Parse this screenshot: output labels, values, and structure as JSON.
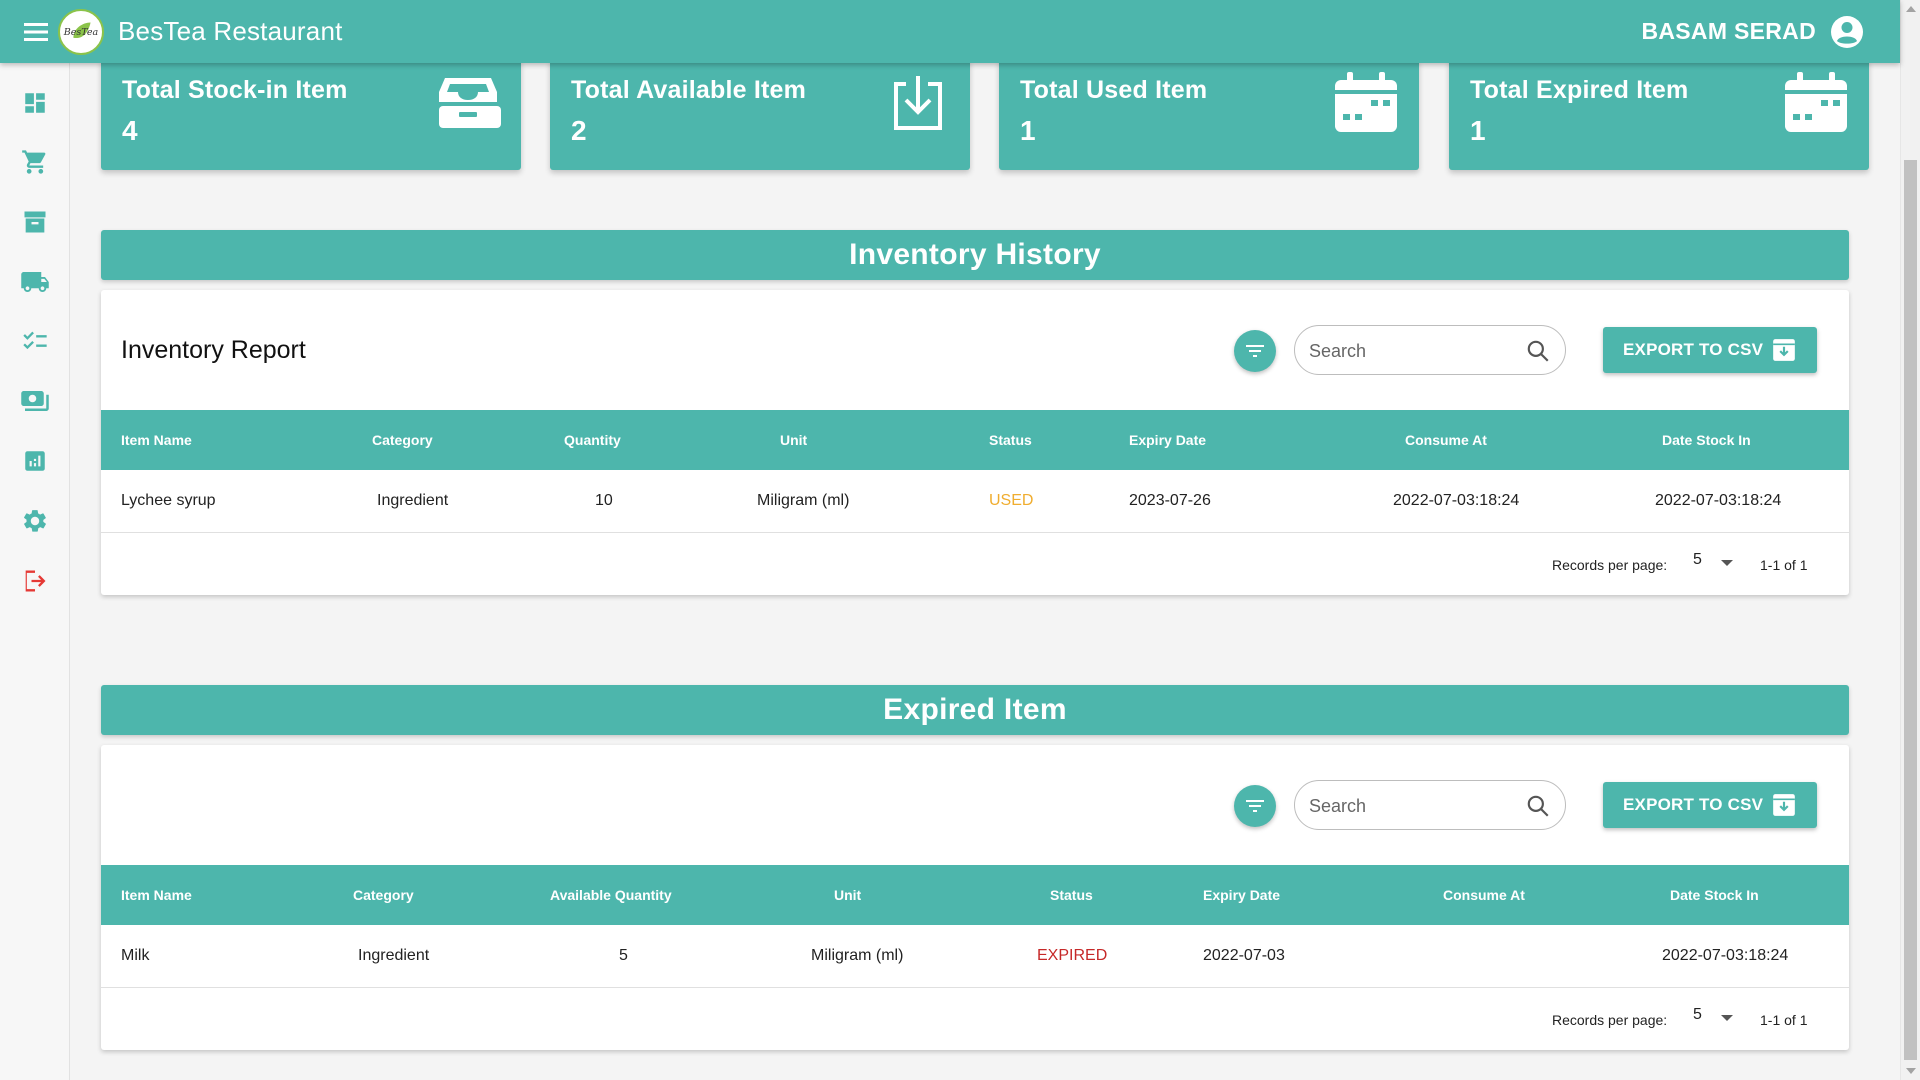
{
  "app": {
    "title": "BesTea Restaurant",
    "logo_text": "BesTea",
    "user_name": "BASAM SERAD",
    "accent_color": "#4db6ac",
    "logout_color": "#e53935"
  },
  "sidebar": {
    "items": [
      {
        "icon": "dashboard-icon"
      },
      {
        "icon": "cart-icon"
      },
      {
        "icon": "archive-icon"
      },
      {
        "icon": "truck-icon"
      },
      {
        "icon": "checklist-icon"
      },
      {
        "icon": "payments-icon"
      },
      {
        "icon": "report-icon"
      },
      {
        "icon": "settings-icon"
      },
      {
        "icon": "logout-icon"
      }
    ]
  },
  "stats": [
    {
      "label": "Total Stock-in Item",
      "value": "4",
      "icon": "inbox-tray-icon"
    },
    {
      "label": "Total Available Item",
      "value": "2",
      "icon": "download-icon"
    },
    {
      "label": "Total Used Item",
      "value": "1",
      "icon": "calendar-icon"
    },
    {
      "label": "Total Expired Item",
      "value": "1",
      "icon": "calendar-icon"
    }
  ],
  "inventory_history": {
    "banner": "Inventory History",
    "panel_title": "Inventory Report",
    "search_placeholder": "Search",
    "export_label": "EXPORT TO CSV",
    "columns": [
      "Item Name",
      "Category",
      "Quantity",
      "Unit",
      "Status",
      "Expiry Date",
      "Consume At",
      "Date Stock In"
    ],
    "rows": [
      {
        "item_name": "Lychee syrup",
        "category": "Ingredient",
        "quantity": "10",
        "unit": "Miligram (ml)",
        "status": "USED",
        "expiry_date": "2023-07-26",
        "consume_at": "2022-07-03:18:24",
        "date_stock_in": "2022-07-03:18:24"
      }
    ],
    "records_per_page_label": "Records per page:",
    "records_per_page": "5",
    "range": "1-1 of 1"
  },
  "expired_items": {
    "banner": "Expired Item",
    "search_placeholder": "Search",
    "export_label": "EXPORT TO CSV",
    "columns": [
      "Item Name",
      "Category",
      "Available Quantity",
      "Unit",
      "Status",
      "Expiry Date",
      "Consume At",
      "Date Stock In"
    ],
    "rows": [
      {
        "item_name": "Milk",
        "category": "Ingredient",
        "quantity": "5",
        "unit": "Miligram (ml)",
        "status": "EXPIRED",
        "expiry_date": "2022-07-03",
        "consume_at": "",
        "date_stock_in": "2022-07-03:18:24"
      }
    ],
    "records_per_page_label": "Records per page:",
    "records_per_page": "5",
    "range": "1-1 of 1"
  }
}
